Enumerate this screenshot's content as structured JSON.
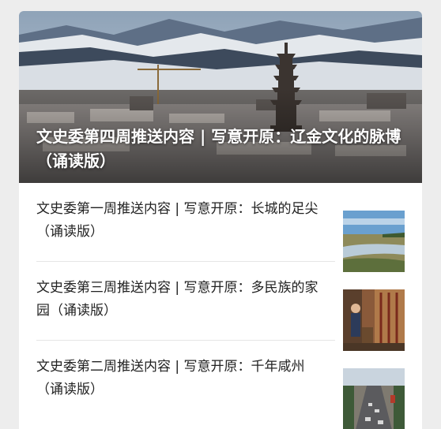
{
  "hero": {
    "title": "文史委第四周推送内容 | 写意开原：辽金文化的脉博（诵读版）"
  },
  "articles": [
    {
      "title": "文史委第一周推送内容 | 写意开原：长城的足尖（诵读版）"
    },
    {
      "title": "文史委第三周推送内容 | 写意开原：多民族的家园（诵读版）"
    },
    {
      "title": "文史委第二周推送内容 | 写意开原：千年咸州（诵读版）"
    }
  ]
}
